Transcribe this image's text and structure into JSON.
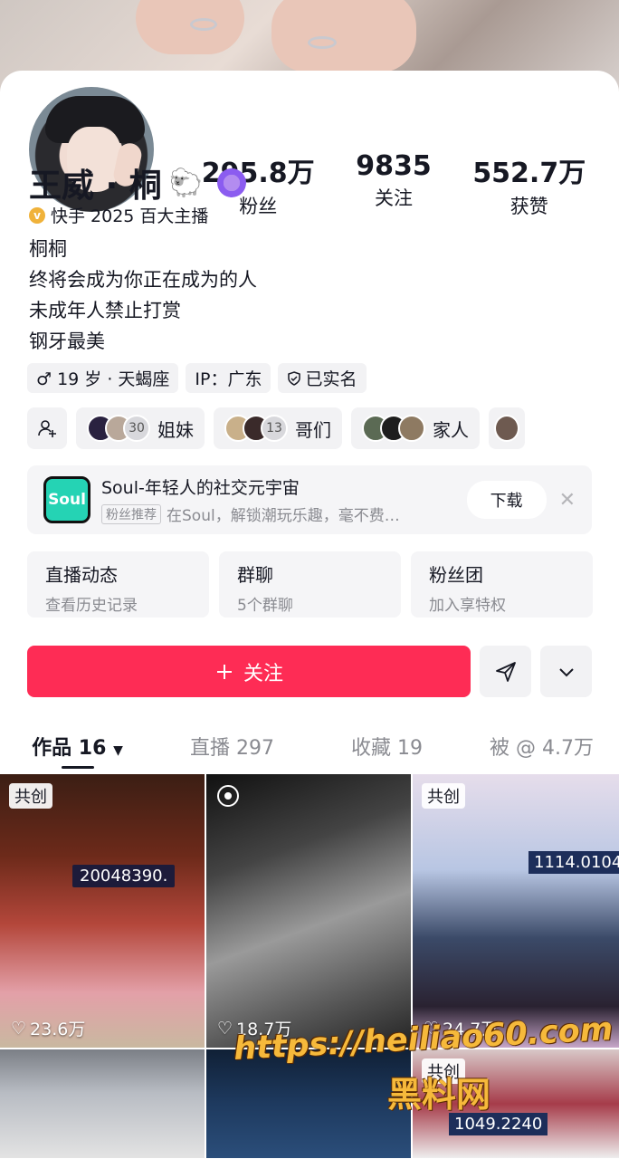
{
  "profile": {
    "name": "王威 · 桐",
    "emoji": "🐑",
    "certification": "快手 2025 百大主播",
    "bio": [
      "桐桐",
      "终将会成为你正在成为的人",
      "未成年人禁止打赏",
      "钢牙最美"
    ]
  },
  "stats": [
    {
      "value": "295.8万",
      "label": "粉丝"
    },
    {
      "value": "9835",
      "label": "关注"
    },
    {
      "value": "552.7万",
      "label": "获赞"
    }
  ],
  "tags": {
    "age": "♂ 19 岁 · 天蝎座",
    "ip": "IP：广东",
    "verified": "已实名"
  },
  "groups": [
    {
      "count": "30",
      "label": "姐妹"
    },
    {
      "count": "13",
      "label": "哥们"
    },
    {
      "count": "",
      "label": "家人"
    }
  ],
  "ad": {
    "logo": "Soul",
    "title": "Soul-年轻人的社交元宇宙",
    "tag": "粉丝推荐",
    "desc": "在Soul，解锁潮玩乐趣，毫不费…",
    "download": "下载",
    "close": "✕"
  },
  "quick": [
    {
      "title": "直播动态",
      "sub": "查看历史记录"
    },
    {
      "title": "群聊",
      "sub": "5个群聊"
    },
    {
      "title": "粉丝团",
      "sub": "加入享特权"
    }
  ],
  "follow_label": "关注",
  "tabs": [
    {
      "label": "作品",
      "count": "16"
    },
    {
      "label": "直播",
      "count": "297"
    },
    {
      "label": "收藏",
      "count": "19"
    },
    {
      "label": "被 @",
      "count": "4.7万"
    }
  ],
  "videos": [
    {
      "chip": "共创",
      "likes": "23.6万",
      "screen": "20048390."
    },
    {
      "chip": "",
      "likes": "18.7万",
      "screen": ""
    },
    {
      "chip": "共创",
      "likes": "24.7万",
      "screen": "1114.0104"
    },
    {
      "chip": "",
      "likes": "",
      "screen": ""
    },
    {
      "chip": "",
      "likes": "",
      "screen": ""
    },
    {
      "chip": "共创",
      "likes": "",
      "screen": "1049.2240"
    }
  ],
  "watermark": {
    "url": "https://heiliao60.com",
    "name": "黑料网"
  },
  "colors": {
    "accent": "#fe2c55",
    "badge": "#8b5cf0",
    "cert": "#f0b23a"
  }
}
